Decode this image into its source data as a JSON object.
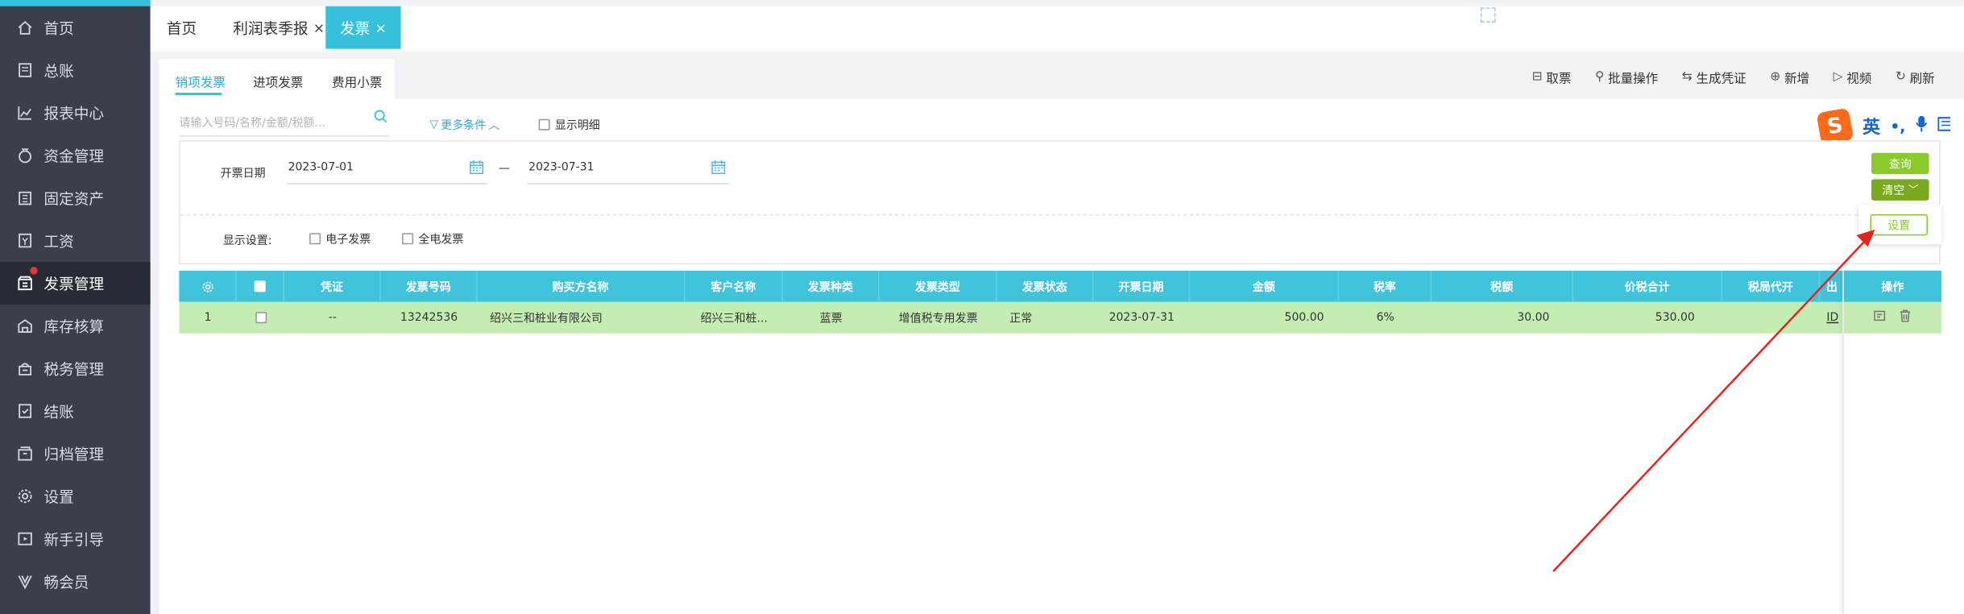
{
  "sidebar": {
    "items": [
      {
        "label": "首页",
        "icon": "home-icon"
      },
      {
        "label": "总账",
        "icon": "ledger-icon"
      },
      {
        "label": "报表中心",
        "icon": "chart-icon"
      },
      {
        "label": "资金管理",
        "icon": "money-bag-icon"
      },
      {
        "label": "固定资产",
        "icon": "building-icon"
      },
      {
        "label": "工资",
        "icon": "payroll-icon"
      },
      {
        "label": "发票管理",
        "icon": "invoice-icon"
      },
      {
        "label": "库存核算",
        "icon": "warehouse-icon"
      },
      {
        "label": "税务管理",
        "icon": "tax-icon"
      },
      {
        "label": "结账",
        "icon": "checkout-icon"
      },
      {
        "label": "归档管理",
        "icon": "archive-icon"
      },
      {
        "label": "设置",
        "icon": "gear-icon"
      },
      {
        "label": "新手引导",
        "icon": "guide-icon"
      },
      {
        "label": "畅会员",
        "icon": "vip-icon"
      }
    ],
    "active_index": 6
  },
  "tabs": [
    {
      "label": "首页",
      "closable": false
    },
    {
      "label": "利润表季报",
      "closable": true,
      "close": "×"
    },
    {
      "label": "发票",
      "closable": true,
      "close": "×",
      "active": true
    }
  ],
  "subtabs": [
    "销项发票",
    "进项发票",
    "费用小票"
  ],
  "toolbar": {
    "items": [
      {
        "label": "取票",
        "icon": "ticket-icon"
      },
      {
        "label": "批量操作",
        "icon": "batch-icon"
      },
      {
        "label": "生成凭证",
        "icon": "voucher-icon"
      },
      {
        "label": "新增",
        "icon": "plus-circle-icon"
      },
      {
        "label": "视频",
        "icon": "play-icon"
      },
      {
        "label": "刷新",
        "icon": "refresh-icon"
      }
    ]
  },
  "search": {
    "placeholder": "请输入号码/名称/金额/税额..."
  },
  "more_conditions": "更多条件",
  "show_detail": "显示明细",
  "filter": {
    "date_label": "开票日期",
    "date_from": "2023-07-01",
    "date_sep": "—",
    "date_to": "2023-07-31",
    "display_label": "显示设置:",
    "opt_electronic": "电子发票",
    "opt_full_electronic": "全电发票"
  },
  "buttons": {
    "query": "查询",
    "clear": "清空",
    "settings": "设置"
  },
  "ime": {
    "lang": "英",
    "punct": "•,"
  },
  "table": {
    "headers": [
      "凭证",
      "发票号码",
      "购买方名称",
      "客户名称",
      "发票种类",
      "发票类型",
      "发票状态",
      "开票日期",
      "金额",
      "税率",
      "税额",
      "价税合计",
      "税局代开",
      "出",
      "操作"
    ],
    "rows": [
      {
        "index": "1",
        "voucher": "--",
        "invoice_no": "13242536",
        "buyer": "绍兴三和桩业有限公司",
        "customer": "绍兴三和桩...",
        "kind": "蓝票",
        "type": "增值税专用发票",
        "status": "正常",
        "date": "2023-07-31",
        "amount": "500.00",
        "rate": "6%",
        "tax": "30.00",
        "total": "530.00",
        "agent": "",
        "out": "ID"
      }
    ]
  },
  "colors": {
    "accent": "#35c1dc",
    "sidebar_bg": "#3a3f4b",
    "row_highlight": "#c4edb2",
    "query_btn": "#8acb2b",
    "arrow": "#e8231b"
  }
}
